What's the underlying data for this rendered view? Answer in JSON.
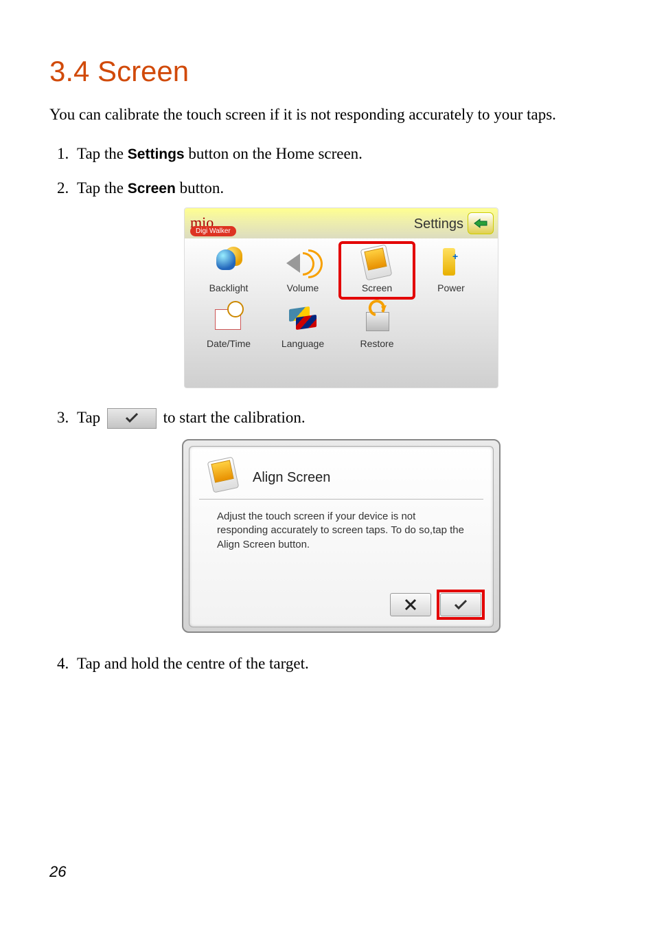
{
  "heading": "3.4   Screen",
  "intro": "You can calibrate the touch screen if it is not responding accurately to your taps.",
  "steps": {
    "s1_a": "Tap the ",
    "s1_b": "Settings",
    "s1_c": " button on the Home screen.",
    "s2_a": "Tap the ",
    "s2_b": "Screen",
    "s2_c": " button.",
    "s3_a": "Tap ",
    "s3_b": " to start the calibration.",
    "s4": "Tap and hold the centre of the target."
  },
  "settings_screen": {
    "logo": "mio",
    "badge": "Digi Walker",
    "title": "Settings",
    "icons": [
      {
        "label": "Backlight"
      },
      {
        "label": "Volume"
      },
      {
        "label": "Screen"
      },
      {
        "label": "Power"
      },
      {
        "label": "Date/Time"
      },
      {
        "label": "Language"
      },
      {
        "label": "Restore"
      }
    ]
  },
  "align_dialog": {
    "title": "Align Screen",
    "desc": "Adjust the touch screen if your device is not responding accurately to screen taps. To do so,tap the Align Screen button."
  },
  "page_number": "26"
}
